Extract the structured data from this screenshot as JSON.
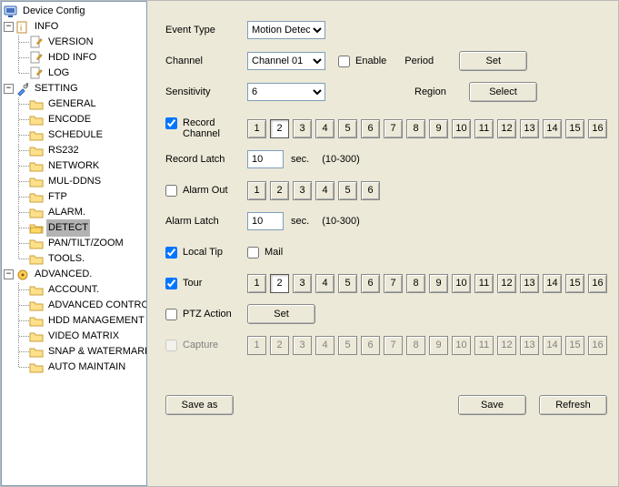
{
  "tree": {
    "root": "Device Config",
    "info": {
      "label": "INFO",
      "items": [
        "VERSION",
        "HDD INFO",
        "LOG"
      ]
    },
    "setting": {
      "label": "SETTING",
      "items": [
        "GENERAL",
        "ENCODE",
        "SCHEDULE",
        "RS232",
        "NETWORK",
        "MUL-DDNS",
        "FTP",
        "ALARM.",
        "DETECT",
        "PAN/TILT/ZOOM",
        "TOOLS."
      ]
    },
    "advanced": {
      "label": "ADVANCED.",
      "items": [
        "ACCOUNT.",
        "ADVANCED CONTROL.",
        "HDD MANAGEMENT",
        "VIDEO MATRIX",
        "SNAP & WATERMARK",
        "AUTO MAINTAIN"
      ]
    }
  },
  "panel": {
    "event_type": {
      "label": "Event Type",
      "value": "Motion Detec"
    },
    "channel": {
      "label": "Channel",
      "value": "Channel  01"
    },
    "sensitivity": {
      "label": "Sensitivity",
      "value": "6"
    },
    "enable_label": "Enable",
    "period_label": "Period",
    "region_label": "Region",
    "set_label": "Set",
    "select_label": "Select",
    "record_channel_label": "Record Channel",
    "record_latch": {
      "label": "Record Latch",
      "value": "10",
      "unit": "sec.",
      "range": "(10-300)"
    },
    "alarm_out_label": "Alarm Out",
    "alarm_latch": {
      "label": "Alarm Latch",
      "value": "10",
      "unit": "sec.",
      "range": "(10-300)"
    },
    "local_tip_label": "Local Tip",
    "mail_label": "Mail",
    "tour_label": "Tour",
    "ptz_label": "PTZ Action",
    "ptz_set_label": "Set",
    "capture_label": "Capture",
    "buttons16": [
      "1",
      "2",
      "3",
      "4",
      "5",
      "6",
      "7",
      "8",
      "9",
      "10",
      "11",
      "12",
      "13",
      "14",
      "15",
      "16"
    ],
    "buttons6": [
      "1",
      "2",
      "3",
      "4",
      "5",
      "6"
    ],
    "record_active": [
      2
    ],
    "tour_active": [
      2
    ],
    "save_as": "Save as",
    "save": "Save",
    "refresh": "Refresh"
  }
}
